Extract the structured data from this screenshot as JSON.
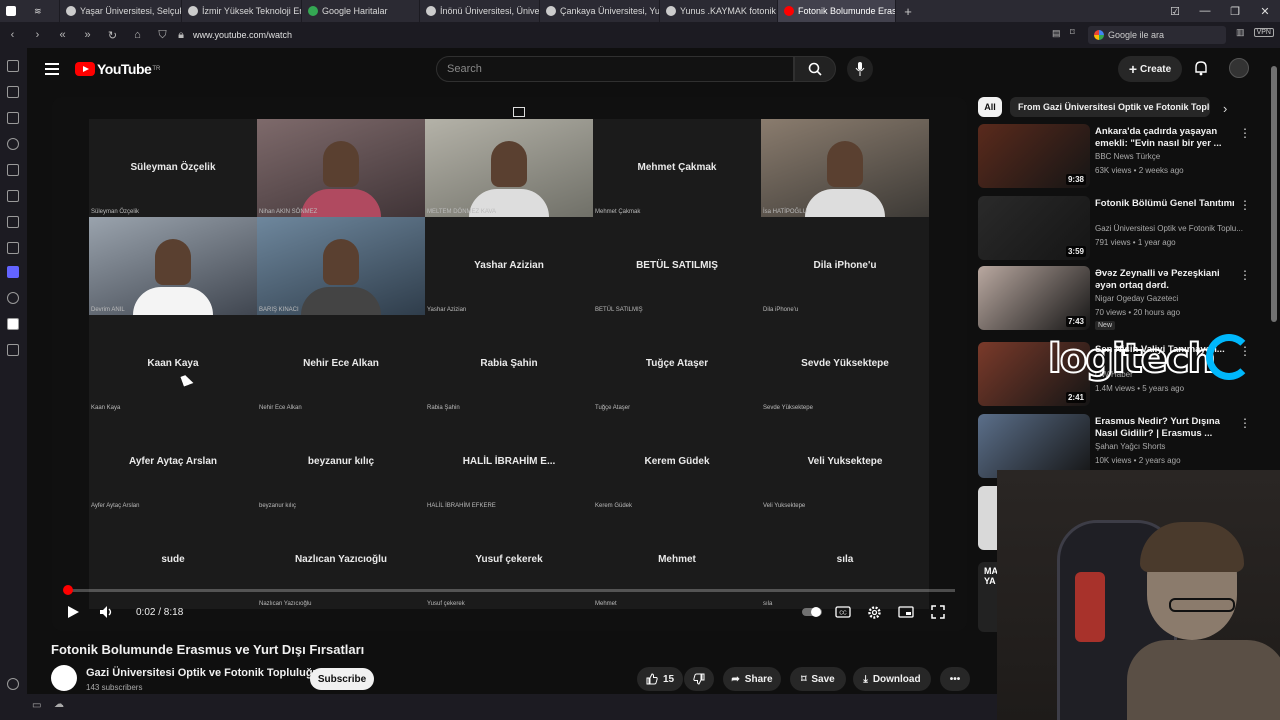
{
  "browser": {
    "tabs": [
      {
        "label": "Yaşar Üniversitesi, Selçuk Ya",
        "color": "#cccccc",
        "active": false
      },
      {
        "label": "İzmir Yüksek Teknoloji Enst",
        "color": "#cccccc",
        "active": false
      },
      {
        "label": "Google Haritalar",
        "color": "#34a853",
        "active": false
      },
      {
        "label": "İnönü Üniversitesi, Üniversi",
        "color": "#cccccc",
        "active": false
      },
      {
        "label": "Çankaya Üniversitesi, Yukar",
        "color": "#cccccc",
        "active": false
      },
      {
        "label": "Yunus .KAYMAK fotonik - G",
        "color": "#cccccc",
        "active": false
      },
      {
        "label": "Fotonik Bolumunde Erasmu",
        "color": "#ff0000",
        "active": true
      }
    ],
    "new_tab_label": "+",
    "url": "www.youtube.com/watch",
    "search_placeholder": "Google ile ara",
    "vpn_label": "VPN"
  },
  "youtube": {
    "logo_text": "YouTube",
    "logo_sup": "TR",
    "search_placeholder": "Search",
    "create_label": "Create"
  },
  "meeting": {
    "participants": [
      {
        "name": "Süleyman Özçelik",
        "small": "Süleyman Özçelik",
        "camera": false
      },
      {
        "name": "",
        "small": "Nihan AKIN SÖNMEZ",
        "camera": true
      },
      {
        "name": "",
        "small": "MELTEM DÖNMEZ KAVA",
        "camera": true
      },
      {
        "name": "Mehmet Çakmak",
        "small": "Mehmet Çakmak",
        "camera": false
      },
      {
        "name": "",
        "small": "İsa HATİPOĞLU",
        "camera": true
      },
      {
        "name": "",
        "small": "Devrim ANIL",
        "camera": true
      },
      {
        "name": "",
        "small": "BARIŞ KINACI",
        "camera": true
      },
      {
        "name": "Yashar Azizian",
        "small": "Yashar Azizian",
        "camera": false
      },
      {
        "name": "BETÜL SATILMIŞ",
        "small": "BETÜL SATILMIŞ",
        "camera": false
      },
      {
        "name": "Dila iPhone'u",
        "small": "Dila iPhone'u",
        "camera": false
      },
      {
        "name": "Kaan Kaya",
        "small": "Kaan Kaya",
        "camera": false
      },
      {
        "name": "Nehir Ece Alkan",
        "small": "Nehir Ece Alkan",
        "camera": false
      },
      {
        "name": "Rabia Şahin",
        "small": "Rabia Şahin",
        "camera": false
      },
      {
        "name": "Tuğçe Ataşer",
        "small": "Tuğçe Ataşer",
        "camera": false
      },
      {
        "name": "Sevde Yüksektepe",
        "small": "Sevde Yüksektepe",
        "camera": false
      },
      {
        "name": "Ayfer Aytaç Arslan",
        "small": "Ayfer Aytaç Arslan",
        "camera": false
      },
      {
        "name": "beyzanur kılıç",
        "small": "beyzanur kılıç",
        "camera": false
      },
      {
        "name": "HALİL İBRAHİM E...",
        "small": "HALİL İBRAHİM EFKERE",
        "camera": false
      },
      {
        "name": "Kerem Güdek",
        "small": "Kerem Güdek",
        "camera": false
      },
      {
        "name": "Veli Yuksektepe",
        "small": "Veli Yuksektepe",
        "camera": false
      },
      {
        "name": "sude",
        "small": "",
        "camera": false
      },
      {
        "name": "Nazlıcan Yazıcıoğlu",
        "small": "Nazlıcan Yazıcıoğlu",
        "camera": false
      },
      {
        "name": "Yusuf çekerek",
        "small": "Yusuf çekerek",
        "camera": false
      },
      {
        "name": "Mehmet",
        "small": "Mehmet",
        "camera": false
      },
      {
        "name": "sıla",
        "small": "sıla",
        "camera": false
      }
    ]
  },
  "player": {
    "time": "0:02 / 8:18",
    "progress_fraction": 0.004
  },
  "video": {
    "title": "Fotonik Bolumunde Erasmus ve Yurt Dışı Fırsatları",
    "channel_name": "Gazi Üniversitesi Optik ve Fotonik Topluluğu",
    "subscribers": "143 subscribers",
    "subscribe_label": "Subscribe",
    "likes": "15",
    "share_label": "Share",
    "save_label": "Save",
    "download_label": "Download"
  },
  "chips": {
    "all": "All",
    "channel": "From Gazi Üniversitesi Optik ve Fotonik Topluluğu"
  },
  "recommendations": [
    {
      "title": "Ankara'da çadırda yaşayan emekli: \"Evin nasıl bir yer ...",
      "channel": "BBC News Türkçe",
      "meta": "63K views • 2 weeks ago",
      "duration": "9:38",
      "new": "",
      "thumb": "#5a2a1c"
    },
    {
      "title": "Fotonik Bölümü Genel Tanıtımı",
      "channel": "Gazi Üniversitesi Optik ve Fotonik Toplu...",
      "meta": "791 views • 1 year ago",
      "duration": "3:59",
      "new": "",
      "thumb": "#2a2a2a"
    },
    {
      "title": "Əvəz Zeynalli və Pezeşkiani əyən ortaq dərd.",
      "channel": "Nigar Ogeday Gazeteci",
      "meta": "70 views • 20 hours ago",
      "duration": "7:43",
      "new": "New",
      "thumb": "#b9a8a0"
    },
    {
      "title": "Sen Nisin Valiyi Tanımayan...",
      "channel": "OW Haber",
      "meta": "1.4M views • 5 years ago",
      "duration": "2:41",
      "new": "",
      "thumb": "#7a3a2a"
    },
    {
      "title": "Erasmus Nedir? Yurt Dışına Nasıl Gidilir? | Erasmus ...",
      "channel": "Şahan Yağcı Shorts",
      "meta": "10K views • 2 years ago",
      "duration": "",
      "new": "",
      "thumb": "#5b6f8a"
    }
  ],
  "overlays": {
    "brand_text": "logitech",
    "partial_thumb_text": "MA YA"
  }
}
